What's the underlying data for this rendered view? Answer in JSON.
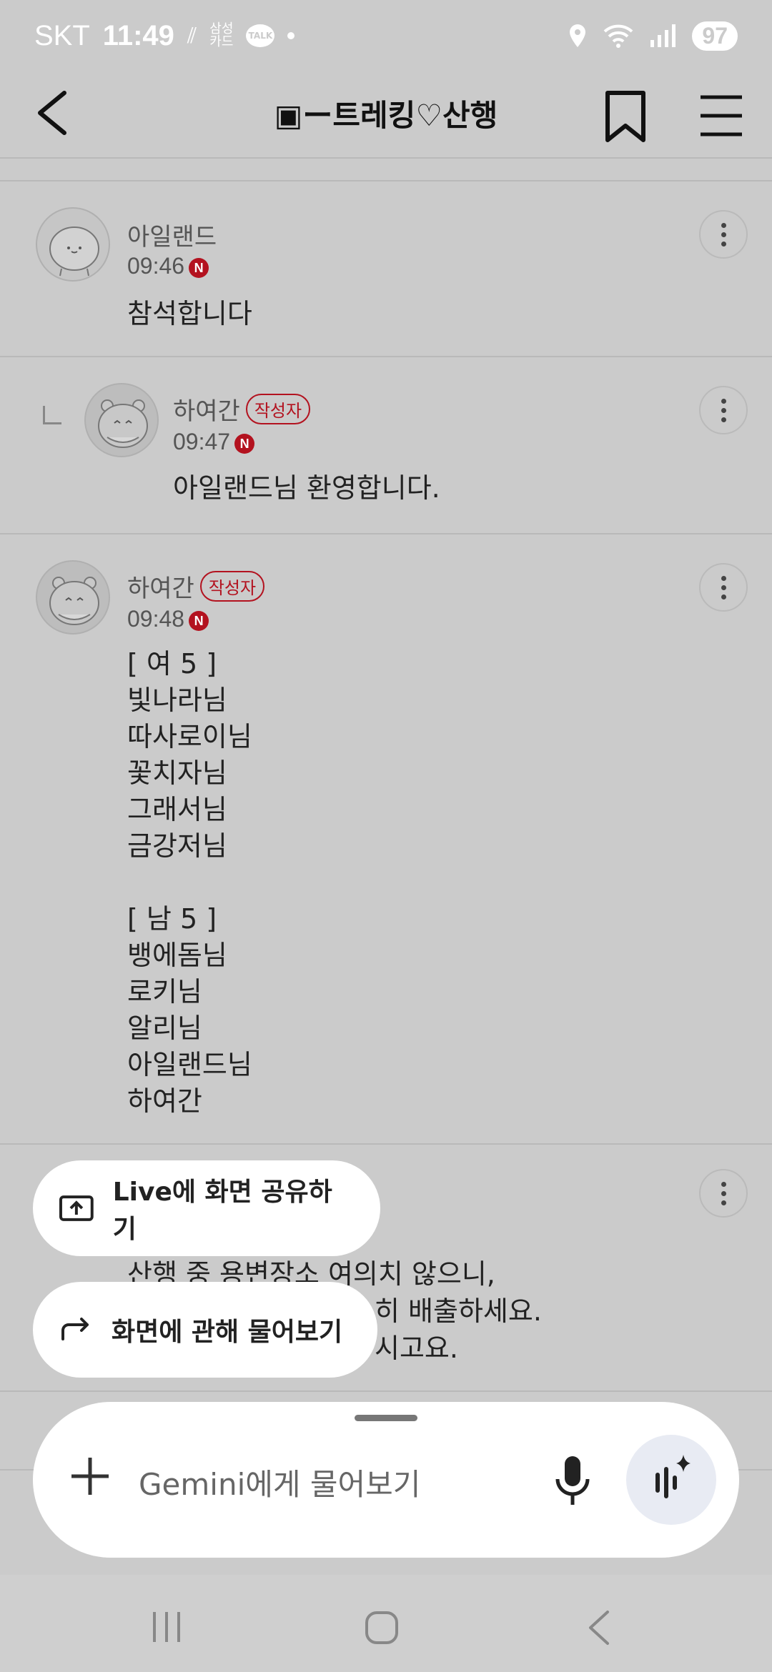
{
  "status_bar": {
    "carrier": "SKT",
    "time": "11:49",
    "samsung_card_line1": "삼성",
    "samsung_card_line2": "카드",
    "talk_label": "TALK",
    "battery": "97"
  },
  "header": {
    "title": "▣ー트레킹♡산행"
  },
  "comments": [
    {
      "name": "아일랜드",
      "time": "09:46",
      "new_badge": "N",
      "body": "참석합니다"
    },
    {
      "name": "하여간",
      "author_badge": "작성자",
      "time": "09:47",
      "new_badge": "N",
      "body": "아일랜드님 환영합니다."
    },
    {
      "name": "하여간",
      "author_badge": "작성자",
      "time": "09:48",
      "new_badge": "N",
      "body": "[ 여 5 ]\n빛나라님\n따사로이님\n꽃치자님\n그래서님\n금강저님\n\n[ 남 5 ]\n뱅에돔님\n로키님\n알리님\n아일랜드님\n하여간"
    }
  ],
  "partial_comment": {
    "line1": "산행 중 용변장소 여의치 않으니,",
    "line2": "히 배출하세요.",
    "line3": "시고요."
  },
  "chips": {
    "live_share": "Live에 화면 공유하기",
    "ask_screen": "화면에 관해 물어보기"
  },
  "gemini": {
    "placeholder": "Gemini에게 물어보기"
  },
  "colors": {
    "accent_red": "#b3121f",
    "background": "#cbcbcb"
  }
}
